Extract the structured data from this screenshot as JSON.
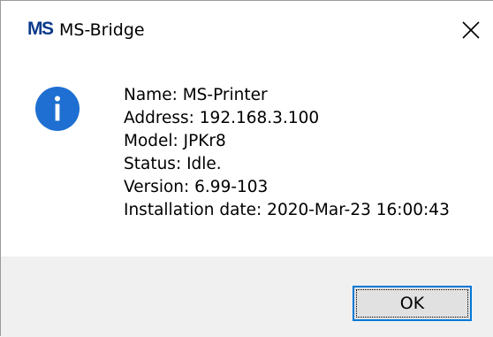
{
  "window": {
    "logo_m": "M",
    "logo_s": "S",
    "title": "MS-Bridge",
    "close_glyph": "✕"
  },
  "info": {
    "lines": [
      "Name: MS-Printer",
      "Address: 192.168.3.100",
      "Model: JPKr8",
      "Status: Idle.",
      "Version: 6.99-103",
      "Installation date: 2020-Mar-23 16:00:43"
    ]
  },
  "buttons": {
    "ok_label": "OK"
  },
  "colors": {
    "info_icon": "#1e6fd1",
    "accent": "#0078d7",
    "footer_bg": "#f0f0f0"
  }
}
